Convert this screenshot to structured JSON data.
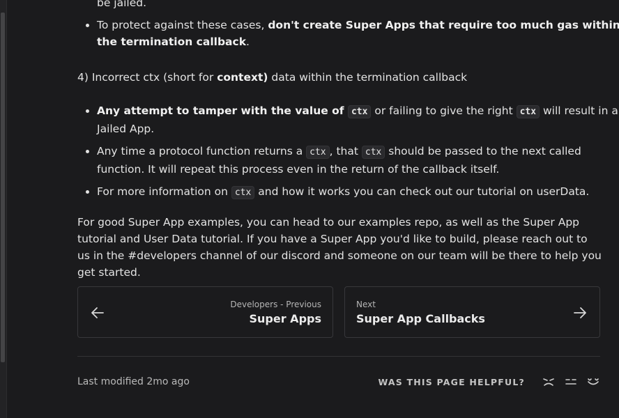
{
  "doc": {
    "jailed_tail": "be jailed.",
    "bullet_gas": {
      "prefix": "To protect against these cases, ",
      "bold": "don't create Super Apps that require too much gas within the termination callback",
      "suffix": "."
    },
    "section4": {
      "prefix": "4) Incorrect ctx (short for ",
      "bold": "context)",
      "suffix": " data within the termination callback"
    },
    "bullet_tamper": {
      "bold": "Any attempt to tamper with the value of ",
      "code1": "ctx",
      "mid": " or failing to give the right ",
      "code2": "ctx",
      "suffix": " will result in a Jailed App."
    },
    "bullet_return": {
      "prefix": "Any time a protocol function returns a ",
      "code1": "ctx",
      "mid": ", that ",
      "code2": "ctx",
      "suffix": " should be passed to the next called function. It will repeat this process even in the return of the callback itself."
    },
    "bullet_info": {
      "prefix": "For more information on ",
      "code": "ctx",
      "suffix": " and how it works you can check out our tutorial on userData."
    },
    "closing": "For good Super App examples, you can head to our examples repo, as well as the Super App tutorial and User Data tutorial. If you have a Super App you'd like to build, please reach out to us in the #developers channel of our discord and someone on our team will be there to help you get started."
  },
  "pager": {
    "prev": {
      "sub": "Developers - Previous",
      "title": "Super Apps",
      "icon": "arrow-left-icon"
    },
    "next": {
      "sub": "Next",
      "title": "Super App Callbacks",
      "icon": "arrow-right-icon"
    }
  },
  "footer": {
    "last_modified": "Last modified 2mo ago",
    "helpful_label": "WAS THIS PAGE HELPFUL?",
    "reactions": [
      "sad-face-icon",
      "neutral-face-icon",
      "happy-face-icon"
    ]
  },
  "colors": {
    "background": "#1b1b1d",
    "text": "#e3e3e3",
    "card_border": "#38383b"
  }
}
